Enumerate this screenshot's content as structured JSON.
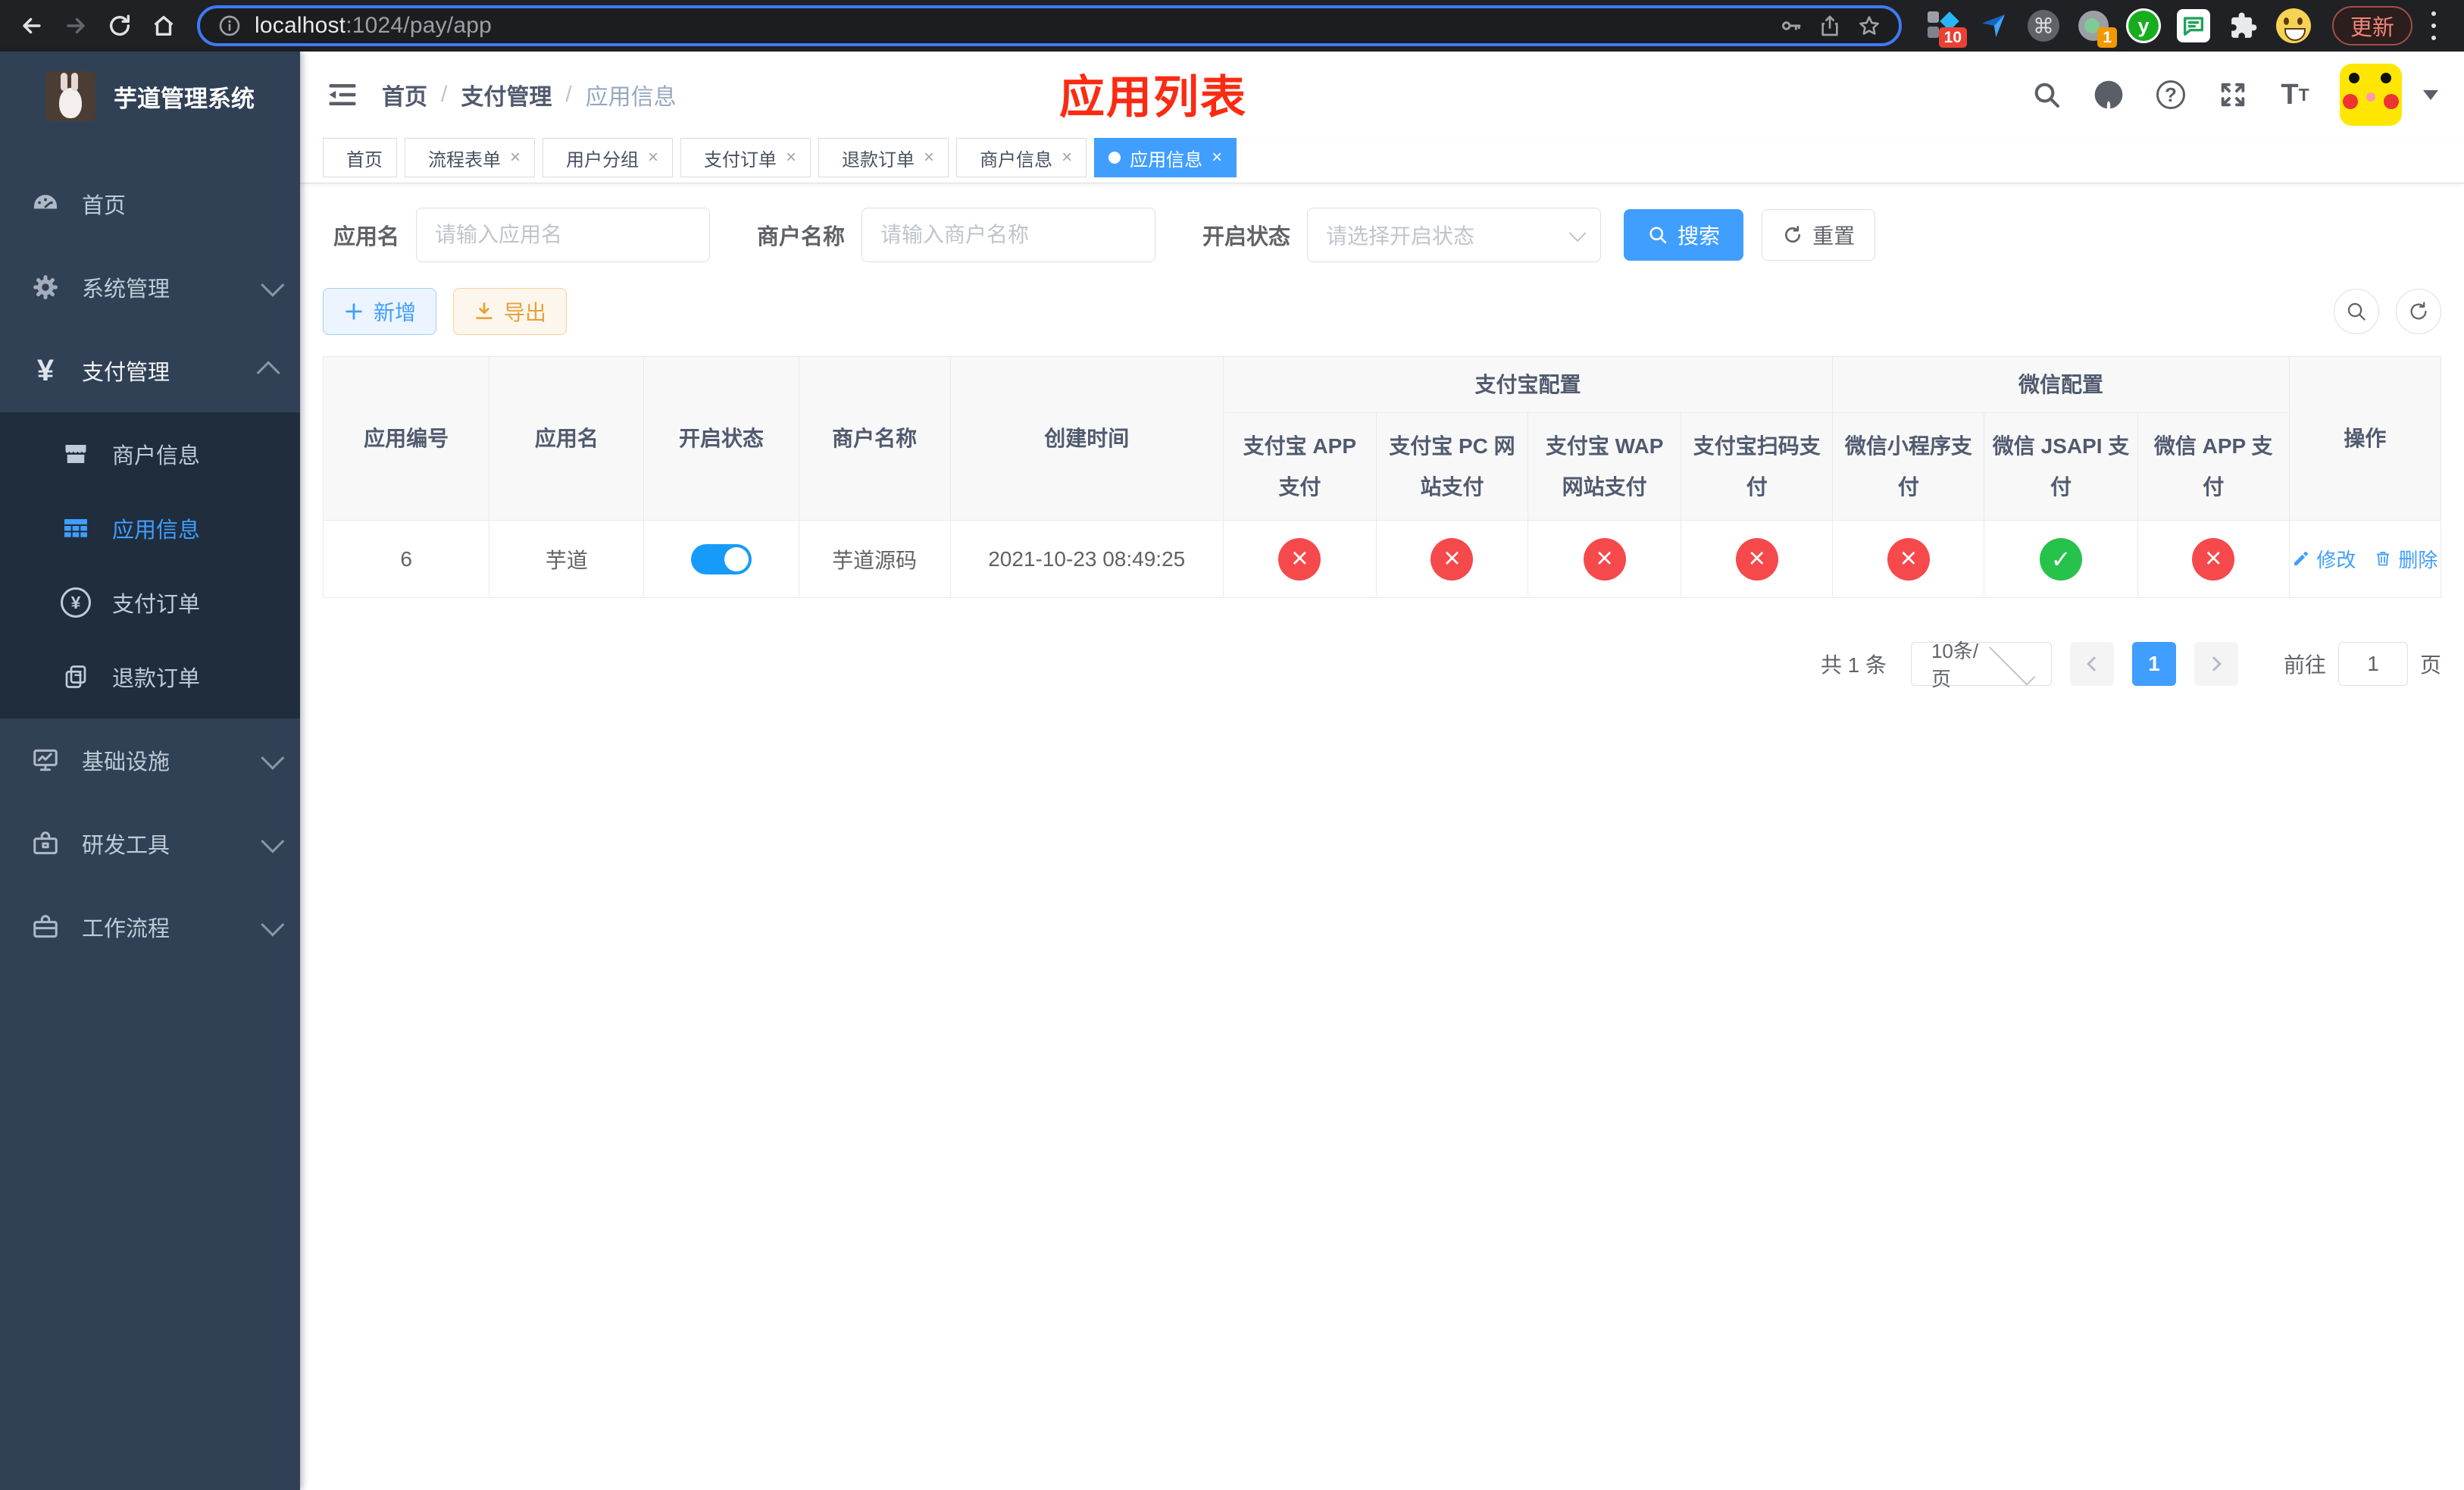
{
  "browser": {
    "url": {
      "host": "localhost",
      "rest": ":1024/pay/app"
    },
    "update_label": "更新",
    "ext_badge_blocks": "10",
    "ext_badge_dot": "1",
    "ext_y_letter": "y"
  },
  "sidebar": {
    "title": "芋道管理系统",
    "menu_top": [
      {
        "label": "首页"
      },
      {
        "label": "系统管理"
      },
      {
        "label": "支付管理"
      }
    ],
    "submenu": [
      {
        "label": "商户信息"
      },
      {
        "label": "应用信息",
        "active": true
      },
      {
        "label": "支付订单"
      },
      {
        "label": "退款订单"
      }
    ],
    "menu_bottom": [
      {
        "label": "基础设施"
      },
      {
        "label": "研发工具"
      },
      {
        "label": "工作流程"
      }
    ]
  },
  "header": {
    "breadcrumb": [
      "首页",
      "支付管理",
      "应用信息"
    ],
    "annotation": "应用列表",
    "help_mark": "?",
    "tabs": [
      {
        "label": "首页",
        "active": false
      },
      {
        "label": "流程表单",
        "active": false
      },
      {
        "label": "用户分组",
        "active": false
      },
      {
        "label": "支付订单",
        "active": false
      },
      {
        "label": "退款订单",
        "active": false
      },
      {
        "label": "商户信息",
        "active": false
      },
      {
        "label": "应用信息",
        "active": true
      }
    ]
  },
  "filters": {
    "app_name_label": "应用名",
    "app_name_placeholder": "请输入应用名",
    "merchant_label": "商户名称",
    "merchant_placeholder": "请输入商户名称",
    "status_label": "开启状态",
    "status_placeholder": "请选择开启状态",
    "search_label": "搜索",
    "reset_label": "重置"
  },
  "toolbar": {
    "add_label": "新增",
    "export_label": "导出"
  },
  "table": {
    "headers": {
      "app_id": "应用编号",
      "app_name": "应用名",
      "open_status": "开启状态",
      "merchant_name": "商户名称",
      "create_time": "创建时间",
      "alipay_group": "支付宝配置",
      "wechat_group": "微信配置",
      "alipay_app": "支付宝 APP 支付",
      "alipay_pc": "支付宝 PC 网站支付",
      "alipay_wap": "支付宝 WAP 网站支付",
      "alipay_scan": "支付宝扫码支付",
      "wechat_mini": "微信小程序支付",
      "wechat_jsapi": "微信 JSAPI 支付",
      "wechat_app": "微信 APP 支付",
      "actions": "操作"
    },
    "row": {
      "app_id": "6",
      "app_name": "芋道",
      "enabled": true,
      "merchant_name": "芋道源码",
      "create_time": "2021-10-23 08:49:25",
      "statuses": {
        "alipay_app": "cross",
        "alipay_pc": "cross",
        "alipay_wap": "cross",
        "alipay_scan": "cross",
        "wechat_mini": "cross",
        "wechat_jsapi": "check",
        "wechat_app": "cross"
      },
      "edit_label": "修改",
      "delete_label": "删除"
    }
  },
  "pagination": {
    "total": "共 1 条",
    "page_size": "10条/页",
    "current_page": "1",
    "goto_label": "前往",
    "goto_value": "1",
    "page_unit": "页"
  }
}
